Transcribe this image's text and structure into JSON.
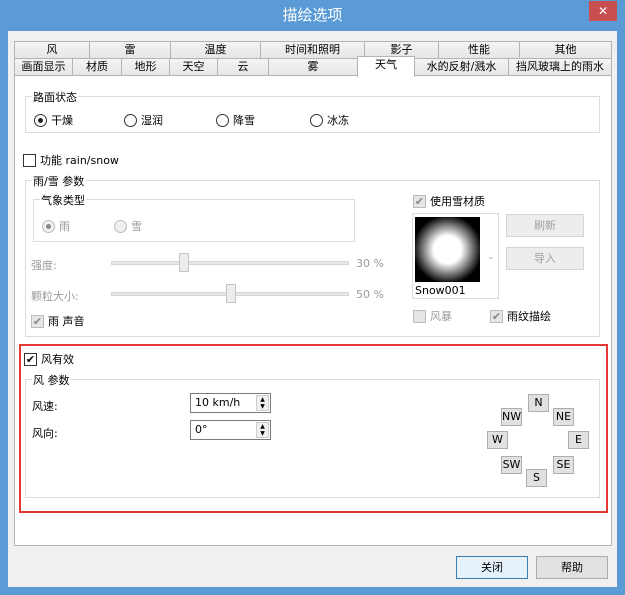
{
  "window": {
    "title": "描绘选项",
    "close_icon": "✕"
  },
  "tabs_row1": [
    "风",
    "雷",
    "温度",
    "时间和照明",
    "影子",
    "性能",
    "其他"
  ],
  "tabs_row2": [
    "画面显示",
    "材质",
    "地形",
    "天空",
    "云",
    "雾",
    "天气",
    "水的反射/溅水",
    "挡风玻璃上的雨水"
  ],
  "road": {
    "legend": "路面状态",
    "options": [
      "干燥",
      "湿润",
      "降雪",
      "冰冻"
    ],
    "selected": 0
  },
  "feature": {
    "label": "功能 rain/snow",
    "checked": false
  },
  "rainsnow": {
    "legend": "雨/雪 参数",
    "weather_legend": "气象类型",
    "weather_options": [
      "雨",
      "雪"
    ],
    "intensity_label": "强度:",
    "intensity_value": "30 %",
    "intensity": 30,
    "particle_label": "颗粒大小:",
    "particle_value": "50 %",
    "particle": 50,
    "rain_sound": "雨 声音",
    "use_snow_material": "使用雪材质",
    "material_name": "Snow001",
    "refresh": "刷新",
    "import": "导入",
    "storm": "风暴",
    "rain_streak": "雨纹描绘"
  },
  "wind": {
    "enabled_label": "风有效",
    "legend": "风 参数",
    "speed_label": "风速:",
    "speed_value": "10 km/h",
    "direction_label": "风向:",
    "direction_value": "0°",
    "directions": {
      "n": "N",
      "nw": "NW",
      "ne": "NE",
      "w": "W",
      "e": "E",
      "sw": "SW",
      "se": "SE",
      "s": "S"
    }
  },
  "footer": {
    "close": "关闭",
    "help": "帮助"
  },
  "colors": {
    "highlight": "#e53935",
    "titlebar": "#5b9bd5"
  }
}
